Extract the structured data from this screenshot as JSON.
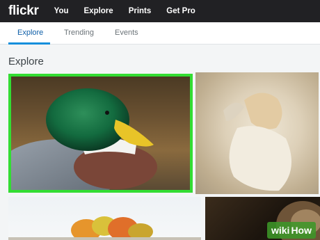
{
  "app": {
    "logo": "flickr"
  },
  "top_nav": {
    "items": [
      "You",
      "Explore",
      "Prints",
      "Get Pro"
    ]
  },
  "sub_nav": {
    "tabs": [
      "Explore",
      "Trending",
      "Events"
    ],
    "active": "Explore"
  },
  "main": {
    "section_title": "Explore",
    "photos": [
      {
        "subject": "mallard duck",
        "selected": true
      },
      {
        "subject": "woman in white dress"
      },
      {
        "subject": "autumn trees"
      },
      {
        "subject": "dark portrait"
      }
    ]
  },
  "watermark": {
    "part1": "wiki",
    "part2": "How"
  },
  "colors": {
    "topbar": "#212124",
    "accent": "#128fdc",
    "selection": "#33dd33"
  }
}
